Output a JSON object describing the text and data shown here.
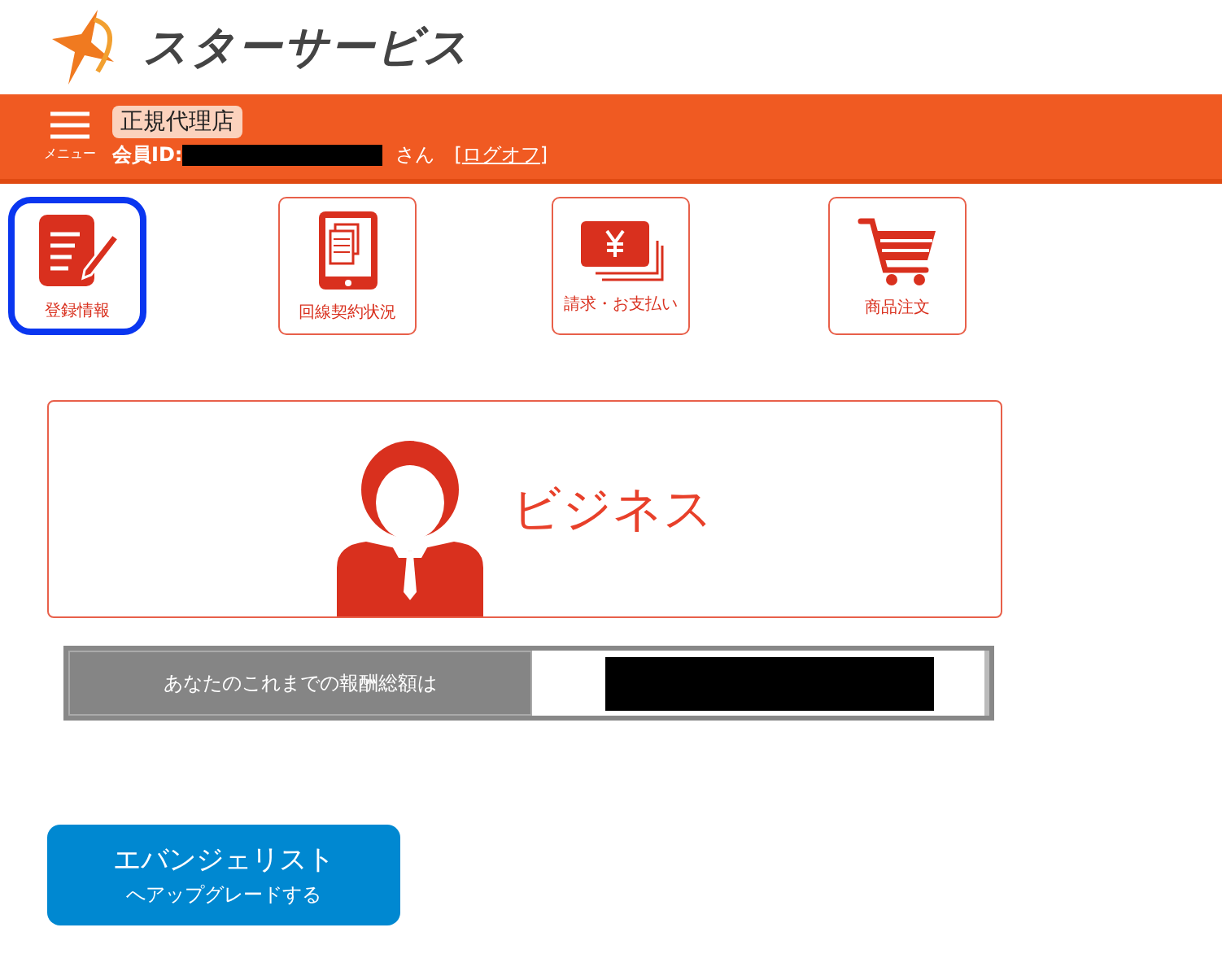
{
  "logo": {
    "text": "スターサービス"
  },
  "header": {
    "menu_label": "メニュー",
    "rank_badge": "正規代理店",
    "member_label": "会員ID:",
    "suffix": "さん",
    "logoff_open": "[",
    "logoff": "ログオフ",
    "logoff_close": "]"
  },
  "tiles": [
    {
      "kind": "form",
      "label": "登録情報",
      "selected": true
    },
    {
      "kind": "tablet",
      "label": "回線契約状況",
      "selected": false
    },
    {
      "kind": "money",
      "label": "請求・お支払い",
      "selected": false
    },
    {
      "kind": "cart",
      "label": "商品注文",
      "selected": false
    }
  ],
  "business_card": {
    "title": "ビジネス"
  },
  "reward": {
    "label": "あなたのこれまでの報酬総額は"
  },
  "upgrade_button": {
    "line_1": "エバンジェリスト",
    "line_2": "へアップグレードする"
  }
}
